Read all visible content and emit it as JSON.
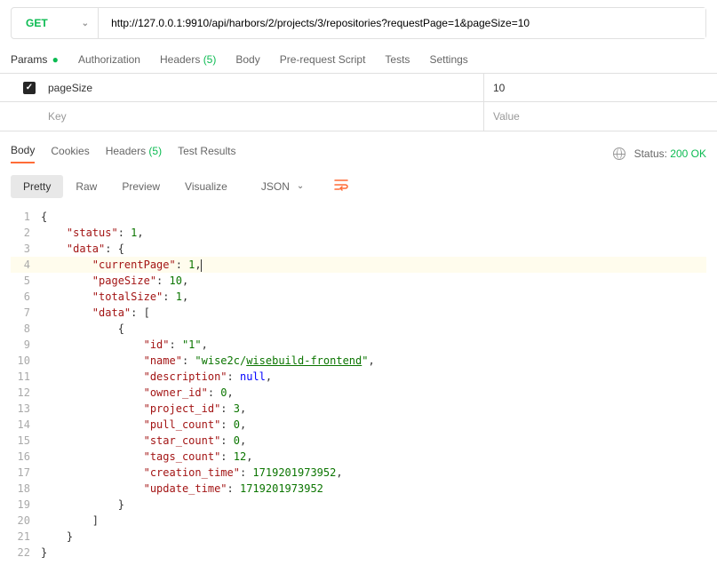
{
  "request": {
    "method": "GET",
    "url": "http://127.0.0.1:9910/api/harbors/2/projects/3/repositories?requestPage=1&pageSize=10"
  },
  "reqTabs": {
    "params": "Params",
    "auth": "Authorization",
    "headers": "Headers",
    "headersCount": "(5)",
    "body": "Body",
    "prescript": "Pre-request Script",
    "tests": "Tests",
    "settings": "Settings"
  },
  "paramsTable": {
    "row1": {
      "key": "pageSize",
      "value": "10"
    },
    "placeholderRow": {
      "key": "Key",
      "value": "Value"
    }
  },
  "respTabs": {
    "body": "Body",
    "cookies": "Cookies",
    "headers": "Headers",
    "headersCount": "(5)",
    "testResults": "Test Results"
  },
  "status": {
    "label": "Status:",
    "value": "200 OK"
  },
  "viewButtons": {
    "pretty": "Pretty",
    "raw": "Raw",
    "preview": "Preview",
    "visualize": "Visualize"
  },
  "format": "JSON",
  "jsonBody": {
    "status": 1,
    "data": {
      "currentPage": 1,
      "pageSize": 10,
      "totalSize": 1,
      "data": [
        {
          "id": "1",
          "name_prefix": "wise2c/",
          "name_link": "wisebuild-frontend",
          "description": "null",
          "owner_id": 0,
          "project_id": 3,
          "pull_count": 0,
          "star_count": 0,
          "tags_count": 12,
          "creation_time": 1719201973952,
          "update_time": 1719201973952
        }
      ]
    }
  }
}
